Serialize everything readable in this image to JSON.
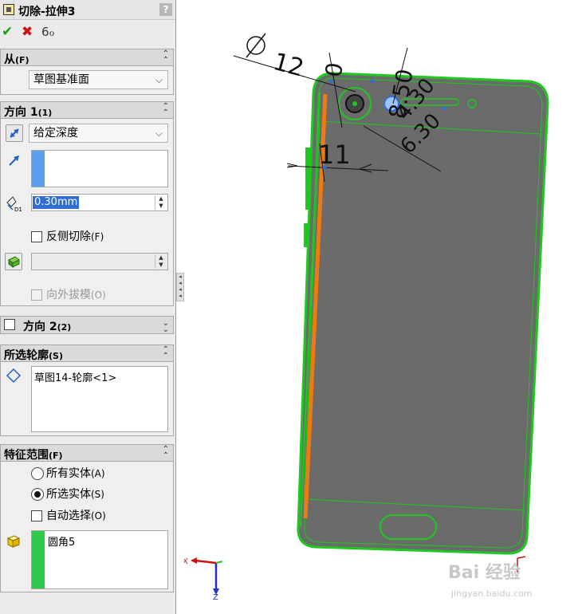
{
  "panel": {
    "title": "切除-拉伸3",
    "help": "?",
    "actions": {
      "ok": "✔",
      "cancel": "✖",
      "preview": "6ℴ"
    },
    "from": {
      "label": "从",
      "shortcut": "(F)",
      "value": "草图基准面"
    },
    "direction1": {
      "label": "方向 1",
      "shortcut": "(1)",
      "end_condition": "给定深度",
      "depth": "0.30mm",
      "flip_side_label": "反侧切除",
      "flip_side_shortcut": "(F)",
      "flip_side_checked": false,
      "draft_outward_label": "向外拔模",
      "draft_outward_shortcut": "(O)"
    },
    "direction2": {
      "label": "方向 2",
      "shortcut": "(2)",
      "checked": false
    },
    "selected_contours": {
      "label": "所选轮廓",
      "shortcut": "(S)",
      "items": [
        "草图14-轮廓<1>"
      ]
    },
    "feature_scope": {
      "label": "特征范围",
      "shortcut": "(F)",
      "all_bodies_label": "所有实体",
      "all_bodies_shortcut": "(A)",
      "selected_bodies_label": "所选实体",
      "selected_bodies_shortcut": "(S)",
      "auto_select_label": "自动选择",
      "auto_select_shortcut": "(O)",
      "selected": "selected_bodies",
      "auto_select_checked": false,
      "bodies": [
        "圆角5"
      ]
    }
  },
  "viewport": {
    "dimensions": [
      "12",
      "0",
      "8.50",
      "4.30",
      "6.30",
      "11"
    ],
    "axis_x": "X",
    "axis_z": "Z",
    "watermark": "Bai 经验",
    "watermark_url": "jingyan.baidu.com"
  },
  "colors": {
    "model_green": "#1ec81e",
    "body_gray": "#6b6b6b",
    "highlight_blue": "#2f6fd4",
    "stripe_blue": "#5aa0f0",
    "stripe_green": "#2ec84a",
    "edge_orange": "#f07a10"
  }
}
